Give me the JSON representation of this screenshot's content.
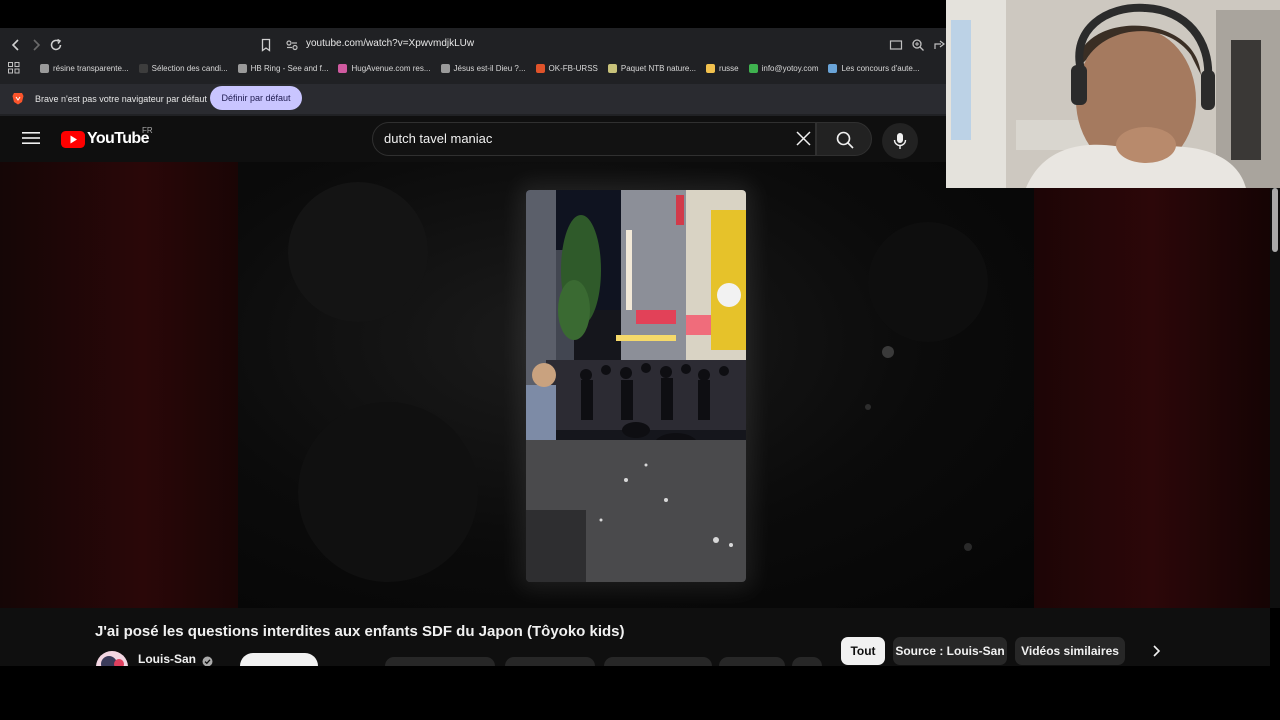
{
  "browser": {
    "url": "youtube.com/watch?v=XpwvmdjkLUw",
    "bookmarks": [
      {
        "label": "résine transparente...",
        "color": "#9a9a9a"
      },
      {
        "label": "Sélection des candi...",
        "color": "#3d3d3d"
      },
      {
        "label": "HB Ring - See and f...",
        "color": "#9a9a9a"
      },
      {
        "label": "HugAvenue.com res...",
        "color": "#d05aa0"
      },
      {
        "label": "Jésus est-il Dieu ?...",
        "color": "#9a9a9a"
      },
      {
        "label": "OK-FB-URSS",
        "color": "#e0532a"
      },
      {
        "label": "Paquet NTB nature...",
        "color": "#c8c27a"
      },
      {
        "label": "russe",
        "color": "#f2c14e"
      },
      {
        "label": "info@yotoy.com",
        "color": "#3fb24f"
      },
      {
        "label": "Les concours d'aute...",
        "color": "#6aa4d8"
      }
    ],
    "infobar_text": "Brave n'est pas votre navigateur par défaut",
    "default_button": "Définir par défaut"
  },
  "youtube": {
    "logo_text": "YouTube",
    "region": "FR",
    "search_value": "dutch tavel maniac",
    "video_title": "J'ai posé les questions interdites aux enfants SDF du Japon (Tôyoko kids)",
    "channel_name": "Louis-San",
    "chips": [
      "Tout",
      "Source : Louis-San",
      "Vidéos similaires"
    ]
  },
  "colors": {
    "youtube_red": "#ff0000",
    "brave_orange": "#fb542b",
    "infobar_button": "#c9c5ff"
  }
}
